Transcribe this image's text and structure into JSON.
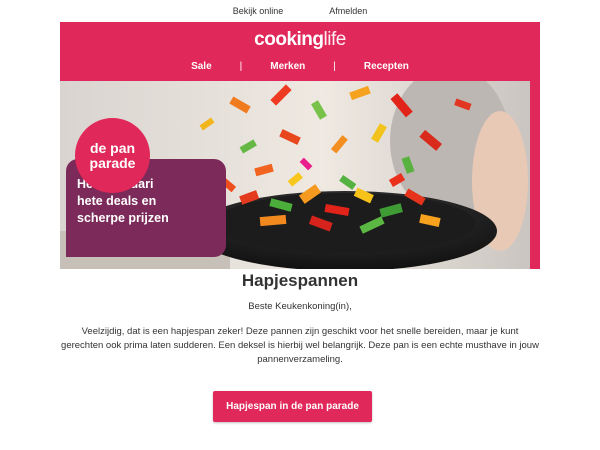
{
  "toplinks": {
    "view_online": "Bekijk online",
    "unsubscribe": "Afmelden"
  },
  "header": {
    "logo_bold": "cooking",
    "logo_light": "life",
    "nav": [
      "Sale",
      "Merken",
      "Recepten"
    ],
    "divider": "|",
    "color": "#e1285a"
  },
  "hero": {
    "badge_line1": "de pan",
    "badge_line2": "parade",
    "promo_lines": [
      "Heel februari",
      "hete deals en",
      "scherpe prijzen"
    ],
    "badge_color": "#e1285a",
    "promo_color": "#7c2a59"
  },
  "content": {
    "title": "Hapjespannen",
    "greeting": "Beste Keukenkoning(in),",
    "body": "Veelzijdig, dat is een hapjespan zeker! Deze pannen zijn geschikt voor het snelle bereiden, maar je kunt gerechten ook prima laten sudderen. Een deksel is hierbij wel belangrijk. Deze pan is een echte musthave in jouw pannenverzameling."
  },
  "cta": {
    "label": "Hapjespan in de pan parade"
  }
}
